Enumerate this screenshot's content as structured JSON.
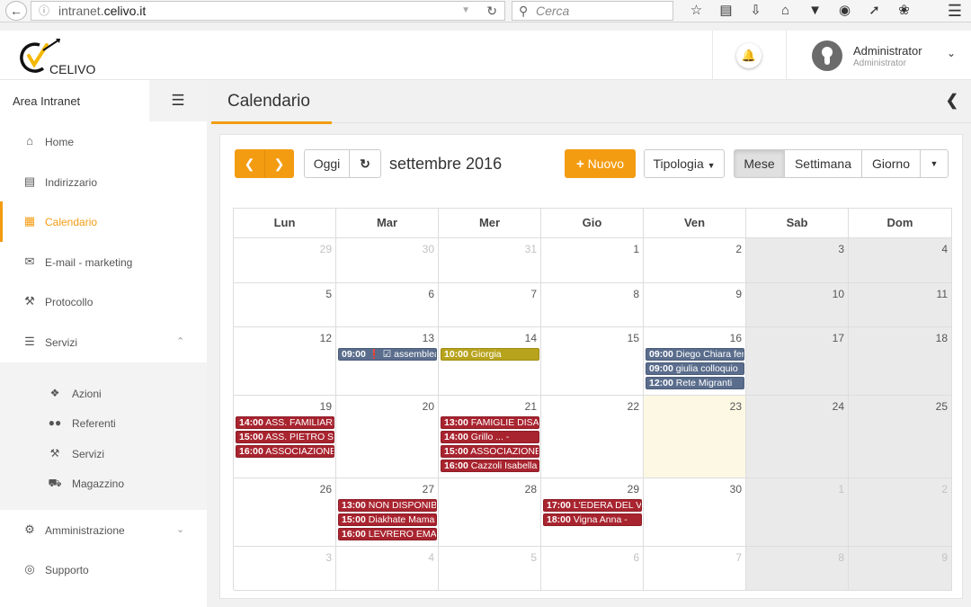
{
  "browser": {
    "url_prefix": "intranet.",
    "url_domain": "celivo.it",
    "search_placeholder": "Cerca"
  },
  "header": {
    "logo_text": "CELIVO",
    "user_name": "Administrator",
    "user_role": "Administrator"
  },
  "sidebar": {
    "title": "Area Intranet",
    "items": [
      {
        "label": "Home",
        "icon": "home-icon"
      },
      {
        "label": "Indirizzario",
        "icon": "address-book-icon"
      },
      {
        "label": "Calendario",
        "icon": "calendar-icon"
      },
      {
        "label": "E-mail - marketing",
        "icon": "envelope-icon"
      },
      {
        "label": "Protocollo",
        "icon": "gavel-icon"
      },
      {
        "label": "Servizi",
        "icon": "server-icon"
      }
    ],
    "sub_items": [
      {
        "label": "Azioni",
        "icon": "tags-icon"
      },
      {
        "label": "Referenti",
        "icon": "users-icon"
      },
      {
        "label": "Servizi",
        "icon": "wrench-icon"
      },
      {
        "label": "Magazzino",
        "icon": "truck-icon"
      }
    ],
    "bottom_items": [
      {
        "label": "Amministrazione",
        "icon": "cogs-icon"
      },
      {
        "label": "Supporto",
        "icon": "life-ring-icon"
      }
    ]
  },
  "page": {
    "title": "Calendario"
  },
  "toolbar": {
    "today": "Oggi",
    "month_title": "settembre 2016",
    "new": "Nuovo",
    "tipologia": "Tipologia",
    "views": [
      "Mese",
      "Settimana",
      "Giorno"
    ]
  },
  "colors": {
    "accent": "#f39c12",
    "event_blue": "#5a6d8c",
    "event_olive": "#b8a31d",
    "event_red": "#a8242f",
    "today_bg": "#fcf8e3"
  },
  "calendar": {
    "weekdays": [
      "Lun",
      "Mar",
      "Mer",
      "Gio",
      "Ven",
      "Sab",
      "Dom"
    ],
    "weeks": [
      [
        {
          "d": "29",
          "o": true
        },
        {
          "d": "30",
          "o": true
        },
        {
          "d": "31",
          "o": true
        },
        {
          "d": "1"
        },
        {
          "d": "2"
        },
        {
          "d": "3"
        },
        {
          "d": "4"
        }
      ],
      [
        {
          "d": "5"
        },
        {
          "d": "6"
        },
        {
          "d": "7"
        },
        {
          "d": "8"
        },
        {
          "d": "9"
        },
        {
          "d": "10"
        },
        {
          "d": "11"
        }
      ],
      [
        {
          "d": "12"
        },
        {
          "d": "13"
        },
        {
          "d": "14"
        },
        {
          "d": "15"
        },
        {
          "d": "16"
        },
        {
          "d": "17"
        },
        {
          "d": "18"
        }
      ],
      [
        {
          "d": "19"
        },
        {
          "d": "20"
        },
        {
          "d": "21"
        },
        {
          "d": "22"
        },
        {
          "d": "23",
          "today": true
        },
        {
          "d": "24"
        },
        {
          "d": "25"
        }
      ],
      [
        {
          "d": "26"
        },
        {
          "d": "27"
        },
        {
          "d": "28"
        },
        {
          "d": "29"
        },
        {
          "d": "30"
        },
        {
          "d": "1",
          "o": true
        },
        {
          "d": "2",
          "o": true
        }
      ],
      [
        {
          "d": "3",
          "o": true
        },
        {
          "d": "4",
          "o": true
        },
        {
          "d": "5",
          "o": true
        },
        {
          "d": "6",
          "o": true
        },
        {
          "d": "7",
          "o": true
        },
        {
          "d": "8",
          "o": true
        },
        {
          "d": "9",
          "o": true
        }
      ]
    ],
    "events": [
      {
        "week": 2,
        "day": 1,
        "slot": 0,
        "time": "09:00",
        "title": "❗ ☑ assemblea",
        "color": "blue"
      },
      {
        "week": 2,
        "day": 2,
        "slot": 0,
        "time": "10:00",
        "title": "Giorgia",
        "color": "olive"
      },
      {
        "week": 2,
        "day": 4,
        "slot": 0,
        "time": "09:00",
        "title": "Diego Chiara fer",
        "color": "blue"
      },
      {
        "week": 2,
        "day": 4,
        "slot": 1,
        "time": "09:00",
        "title": "giulia colloquio",
        "color": "blue"
      },
      {
        "week": 2,
        "day": 4,
        "slot": 2,
        "time": "12:00",
        "title": "Rete Migranti",
        "color": "blue"
      },
      {
        "week": 3,
        "day": 0,
        "slot": 0,
        "time": "14:00",
        "title": "ASS. FAMILIARI (",
        "color": "red"
      },
      {
        "week": 3,
        "day": 0,
        "slot": 1,
        "time": "15:00",
        "title": "ASS. PIETRO SA",
        "color": "red"
      },
      {
        "week": 3,
        "day": 0,
        "slot": 2,
        "time": "16:00",
        "title": "ASSOCIAZIONE (",
        "color": "red"
      },
      {
        "week": 3,
        "day": 2,
        "slot": 0,
        "time": "13:00",
        "title": "FAMIGLIE DISAB",
        "color": "red"
      },
      {
        "week": 3,
        "day": 2,
        "slot": 1,
        "time": "14:00",
        "title": "Grillo ... -",
        "color": "red"
      },
      {
        "week": 3,
        "day": 2,
        "slot": 2,
        "time": "15:00",
        "title": "ASSOCIAZIONE I",
        "color": "red"
      },
      {
        "week": 3,
        "day": 2,
        "slot": 3,
        "time": "16:00",
        "title": "Cazzoli Isabella",
        "color": "red"
      },
      {
        "week": 4,
        "day": 1,
        "slot": 0,
        "time": "13:00",
        "title": "NON DISPONIBI",
        "color": "red"
      },
      {
        "week": 4,
        "day": 1,
        "slot": 1,
        "time": "15:00",
        "title": "Diakhate Mama",
        "color": "red"
      },
      {
        "week": 4,
        "day": 1,
        "slot": 2,
        "time": "16:00",
        "title": "LEVRERO EMAN",
        "color": "red"
      },
      {
        "week": 4,
        "day": 3,
        "slot": 0,
        "time": "17:00",
        "title": "L'EDERA DEL VC",
        "color": "red"
      },
      {
        "week": 4,
        "day": 3,
        "slot": 1,
        "time": "18:00",
        "title": "Vigna Anna -",
        "color": "red"
      }
    ]
  }
}
